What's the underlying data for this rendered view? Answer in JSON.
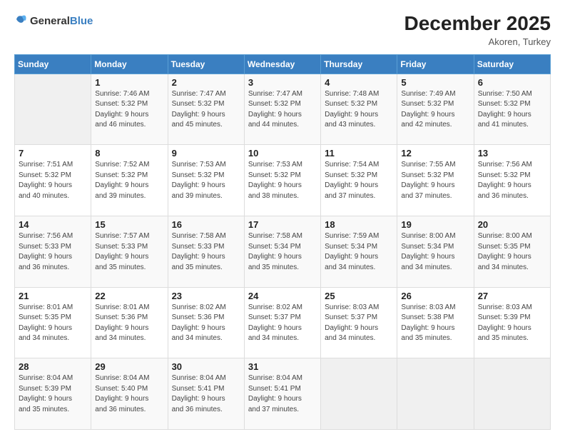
{
  "header": {
    "logo_general": "General",
    "logo_blue": "Blue",
    "month_title": "December 2025",
    "location": "Akoren, Turkey"
  },
  "days_of_week": [
    "Sunday",
    "Monday",
    "Tuesday",
    "Wednesday",
    "Thursday",
    "Friday",
    "Saturday"
  ],
  "weeks": [
    [
      {
        "day": "",
        "detail": ""
      },
      {
        "day": "1",
        "detail": "Sunrise: 7:46 AM\nSunset: 5:32 PM\nDaylight: 9 hours\nand 46 minutes."
      },
      {
        "day": "2",
        "detail": "Sunrise: 7:47 AM\nSunset: 5:32 PM\nDaylight: 9 hours\nand 45 minutes."
      },
      {
        "day": "3",
        "detail": "Sunrise: 7:47 AM\nSunset: 5:32 PM\nDaylight: 9 hours\nand 44 minutes."
      },
      {
        "day": "4",
        "detail": "Sunrise: 7:48 AM\nSunset: 5:32 PM\nDaylight: 9 hours\nand 43 minutes."
      },
      {
        "day": "5",
        "detail": "Sunrise: 7:49 AM\nSunset: 5:32 PM\nDaylight: 9 hours\nand 42 minutes."
      },
      {
        "day": "6",
        "detail": "Sunrise: 7:50 AM\nSunset: 5:32 PM\nDaylight: 9 hours\nand 41 minutes."
      }
    ],
    [
      {
        "day": "7",
        "detail": "Sunrise: 7:51 AM\nSunset: 5:32 PM\nDaylight: 9 hours\nand 40 minutes."
      },
      {
        "day": "8",
        "detail": "Sunrise: 7:52 AM\nSunset: 5:32 PM\nDaylight: 9 hours\nand 39 minutes."
      },
      {
        "day": "9",
        "detail": "Sunrise: 7:53 AM\nSunset: 5:32 PM\nDaylight: 9 hours\nand 39 minutes."
      },
      {
        "day": "10",
        "detail": "Sunrise: 7:53 AM\nSunset: 5:32 PM\nDaylight: 9 hours\nand 38 minutes."
      },
      {
        "day": "11",
        "detail": "Sunrise: 7:54 AM\nSunset: 5:32 PM\nDaylight: 9 hours\nand 37 minutes."
      },
      {
        "day": "12",
        "detail": "Sunrise: 7:55 AM\nSunset: 5:32 PM\nDaylight: 9 hours\nand 37 minutes."
      },
      {
        "day": "13",
        "detail": "Sunrise: 7:56 AM\nSunset: 5:32 PM\nDaylight: 9 hours\nand 36 minutes."
      }
    ],
    [
      {
        "day": "14",
        "detail": "Sunrise: 7:56 AM\nSunset: 5:33 PM\nDaylight: 9 hours\nand 36 minutes."
      },
      {
        "day": "15",
        "detail": "Sunrise: 7:57 AM\nSunset: 5:33 PM\nDaylight: 9 hours\nand 35 minutes."
      },
      {
        "day": "16",
        "detail": "Sunrise: 7:58 AM\nSunset: 5:33 PM\nDaylight: 9 hours\nand 35 minutes."
      },
      {
        "day": "17",
        "detail": "Sunrise: 7:58 AM\nSunset: 5:34 PM\nDaylight: 9 hours\nand 35 minutes."
      },
      {
        "day": "18",
        "detail": "Sunrise: 7:59 AM\nSunset: 5:34 PM\nDaylight: 9 hours\nand 34 minutes."
      },
      {
        "day": "19",
        "detail": "Sunrise: 8:00 AM\nSunset: 5:34 PM\nDaylight: 9 hours\nand 34 minutes."
      },
      {
        "day": "20",
        "detail": "Sunrise: 8:00 AM\nSunset: 5:35 PM\nDaylight: 9 hours\nand 34 minutes."
      }
    ],
    [
      {
        "day": "21",
        "detail": "Sunrise: 8:01 AM\nSunset: 5:35 PM\nDaylight: 9 hours\nand 34 minutes."
      },
      {
        "day": "22",
        "detail": "Sunrise: 8:01 AM\nSunset: 5:36 PM\nDaylight: 9 hours\nand 34 minutes."
      },
      {
        "day": "23",
        "detail": "Sunrise: 8:02 AM\nSunset: 5:36 PM\nDaylight: 9 hours\nand 34 minutes."
      },
      {
        "day": "24",
        "detail": "Sunrise: 8:02 AM\nSunset: 5:37 PM\nDaylight: 9 hours\nand 34 minutes."
      },
      {
        "day": "25",
        "detail": "Sunrise: 8:03 AM\nSunset: 5:37 PM\nDaylight: 9 hours\nand 34 minutes."
      },
      {
        "day": "26",
        "detail": "Sunrise: 8:03 AM\nSunset: 5:38 PM\nDaylight: 9 hours\nand 35 minutes."
      },
      {
        "day": "27",
        "detail": "Sunrise: 8:03 AM\nSunset: 5:39 PM\nDaylight: 9 hours\nand 35 minutes."
      }
    ],
    [
      {
        "day": "28",
        "detail": "Sunrise: 8:04 AM\nSunset: 5:39 PM\nDaylight: 9 hours\nand 35 minutes."
      },
      {
        "day": "29",
        "detail": "Sunrise: 8:04 AM\nSunset: 5:40 PM\nDaylight: 9 hours\nand 36 minutes."
      },
      {
        "day": "30",
        "detail": "Sunrise: 8:04 AM\nSunset: 5:41 PM\nDaylight: 9 hours\nand 36 minutes."
      },
      {
        "day": "31",
        "detail": "Sunrise: 8:04 AM\nSunset: 5:41 PM\nDaylight: 9 hours\nand 37 minutes."
      },
      {
        "day": "",
        "detail": ""
      },
      {
        "day": "",
        "detail": ""
      },
      {
        "day": "",
        "detail": ""
      }
    ]
  ]
}
